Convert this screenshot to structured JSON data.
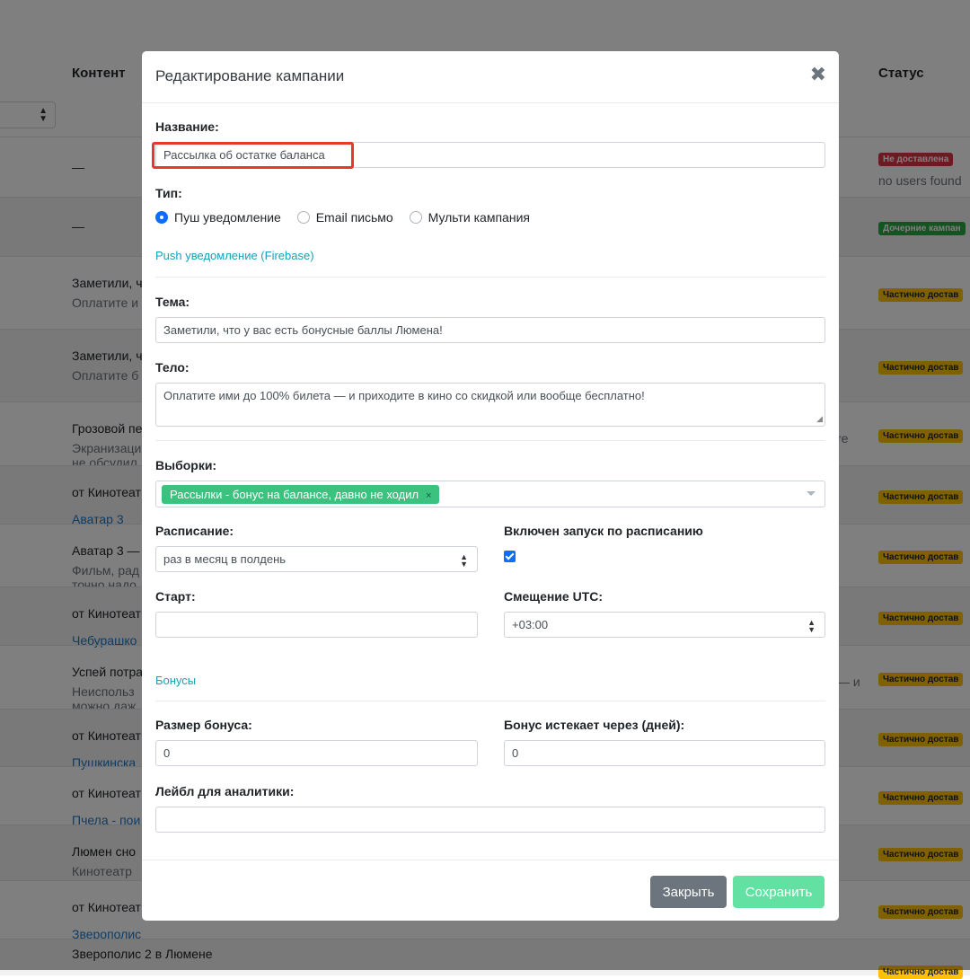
{
  "background": {
    "columns": {
      "content": "Контент",
      "status": "Статус"
    },
    "rows": [
      {
        "title": "—",
        "sub": "",
        "link": "",
        "badge": "Не доставлена",
        "badge_color": "red",
        "note": "no users found",
        "right": ""
      },
      {
        "title": "—",
        "sub": "",
        "link": "",
        "badge": "Дочерние кампан",
        "badge_color": "green",
        "note": "",
        "right": ""
      },
      {
        "title": "Заметили, ч",
        "sub": "Оплатите и",
        "link": "",
        "badge": "Частично достав",
        "badge_color": "yellow",
        "note": "",
        "right": ""
      },
      {
        "title": "Заметили, ч",
        "sub": "Оплатите б",
        "link": "",
        "badge": "Частично достав",
        "badge_color": "yellow",
        "note": "",
        "right": ""
      },
      {
        "title": "Грозовой пе",
        "sub": "Экранизаци",
        "sub2": "не обсудил",
        "link": "",
        "badge": "Частично достав",
        "badge_color": "yellow",
        "note": "",
        "right": "re"
      },
      {
        "title": "от Кинотеат",
        "sub": "",
        "link": "Аватар 3",
        "badge": "Частично достав",
        "badge_color": "yellow",
        "note": "",
        "right": ""
      },
      {
        "title": "Аватар 3 —",
        "sub": "Фильм, рад",
        "sub2": "точно надо",
        "link": "",
        "badge": "Частично достав",
        "badge_color": "yellow",
        "note": "",
        "right": ""
      },
      {
        "title": "от Кинотеат",
        "sub": "",
        "link": "Чебурашко",
        "badge": "Частично достав",
        "badge_color": "yellow",
        "note": "",
        "right": ""
      },
      {
        "title": "Успей потра",
        "sub": "Неиспольз",
        "sub2": "можно даж",
        "link": "",
        "badge": "Частично достав",
        "badge_color": "yellow",
        "note": "",
        "right": "— и"
      },
      {
        "title": "от Кинотеат",
        "sub": "",
        "link": "Пушкинска",
        "badge": "Частично достав",
        "badge_color": "yellow",
        "note": "",
        "right": ""
      },
      {
        "title": "от Кинотеат",
        "sub": "",
        "link": "Пчела - пои",
        "badge": "Частично достав",
        "badge_color": "yellow",
        "note": "",
        "right": ""
      },
      {
        "title": "Люмен сно",
        "sub": "Кинотеатр",
        "link": "",
        "badge": "Частично достав",
        "badge_color": "yellow",
        "note": "",
        "right": ""
      },
      {
        "title": "от Кинотеат",
        "sub": "",
        "link": "Зверополис 2",
        "badge": "Частично достав",
        "badge_color": "yellow",
        "note": "",
        "right": ""
      },
      {
        "title": "Зверополис 2 в Люмене",
        "sub": "",
        "link": "",
        "badge": "Частично достав",
        "badge_color": "yellow",
        "note": "",
        "right": ""
      }
    ]
  },
  "modal": {
    "title": "Редактирование кампании",
    "close_icon": "✖",
    "name_label": "Название:",
    "name_value": "Рассылка об остатке баланса",
    "type_label": "Тип:",
    "type_options": [
      "Пуш уведомление",
      "Email письмо",
      "Мульти кампания"
    ],
    "type_selected": 0,
    "push_section": "Push уведомление (Firebase)",
    "subject_label": "Тема:",
    "subject_value": "Заметили, что у вас есть бонусные баллы Люмена!",
    "body_label": "Тело:",
    "body_value": "Оплатите ими до 100% билета — и приходите в кино со скидкой или вообще бесплатно!",
    "segments_label": "Выборки:",
    "segment_tag": "Рассылки - бонус на балансе, давно не ходил",
    "segment_tag_remove": "×",
    "schedule_label": "Расписание:",
    "schedule_value": "раз в месяц в полдень",
    "schedule_enabled_label": "Включен запуск по расписанию",
    "schedule_enabled": true,
    "start_label": "Старт:",
    "start_value": "",
    "utc_label": "Смещение UTC:",
    "utc_value": "+03:00",
    "bonus_section": "Бонусы",
    "bonus_size_label": "Размер бонуса:",
    "bonus_size_value": "0",
    "bonus_expire_label": "Бонус истекает через (дней):",
    "bonus_expire_value": "0",
    "analytics_label": "Лейбл для аналитики:",
    "analytics_value": "",
    "close_button": "Закрыть",
    "save_button": "Сохранить"
  },
  "colors": {
    "overlay": "rgba(0,0,0,0.5)",
    "accent_teal": "#17a2b8",
    "tag_green": "#3cc27f",
    "save_green": "#62e1a3",
    "highlight_red": "#e53a2a"
  }
}
